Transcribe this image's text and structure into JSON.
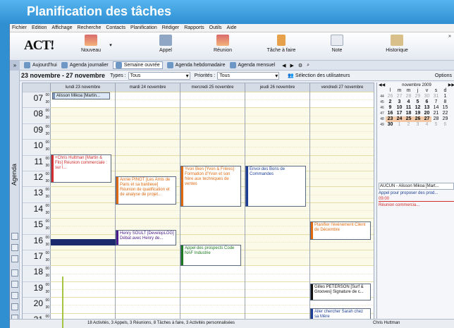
{
  "banner_title": "Planification des tâches",
  "menu": [
    "Fichier",
    "Edition",
    "Affichage",
    "Recherche",
    "Contacts",
    "Planification",
    "Rédiger",
    "Rapports",
    "Outils",
    "Aide"
  ],
  "toolbar": {
    "logo": "ACT!",
    "buttons": [
      "Nouveau",
      "Appel",
      "Réunion",
      "Tâche à faire",
      "Note",
      "Historique"
    ]
  },
  "nav": {
    "chevron": "»",
    "items": [
      "Aujourd'hui",
      "Agenda journalier",
      "Semaine ouvrée",
      "Agenda hebdomadaire",
      "Agenda mensuel"
    ]
  },
  "daterow": {
    "range": "23 novembre - 27 novembre",
    "types_label": "Types :",
    "types_value": "Tous",
    "prio_label": "Priorités :",
    "prio_value": "Tous",
    "users_label": "Sélection des utilisateurs",
    "options_label": "Options"
  },
  "agenda_label": "Agenda",
  "days": [
    "lundi 23 novembre",
    "mardi 24 novembre",
    "mercredi 25 novembre",
    "jeudi 26 novembre",
    "vendredi 27 novembre"
  ],
  "banner_event": "Alisson Mikoa [Martin...",
  "hours": [
    "07",
    "08",
    "09",
    "10",
    "11",
    "12",
    "13",
    "14",
    "15",
    "16",
    "17",
    "18",
    "19",
    "20",
    "21"
  ],
  "mins": [
    "00",
    "30"
  ],
  "events": [
    {
      "text": "+Chris Hultman [Martin & Fils] Réunion commerciale : sur l..."
    },
    {
      "text": "Annie PINOT [Les Amis de Paris et sa banlieue] Réunion de qualification et de analyse de projet..."
    },
    {
      "text": "Yvon Bien [Yvon & Frères] Formation d'Yvon et son frère aux techniques de ventes"
    },
    {
      "text": "Envoi des Bons de Commandes"
    },
    {
      "text": "Planifier l'événement Client de Décembre"
    },
    {
      "text": "Henry SOULT [DevelopLOG] Débat avec Henry de..."
    },
    {
      "text": "Appel des prospects Code NAF Industrie"
    },
    {
      "text": "Gilles PETERSON [Surf & Grooves] Signature de c..."
    },
    {
      "text": "Aller chercher Sarah chez sa Mère"
    }
  ],
  "calendar": {
    "month": "novembre 2009",
    "dow": [
      "l",
      "m",
      "m",
      "j",
      "v",
      "s",
      "d"
    ],
    "weeks": [
      [
        "44",
        "26",
        "27",
        "28",
        "29",
        "30",
        "31",
        "1"
      ],
      [
        "45",
        "2",
        "3",
        "4",
        "5",
        "6",
        "7",
        "8"
      ],
      [
        "46",
        "9",
        "10",
        "11",
        "12",
        "13",
        "14",
        "15"
      ],
      [
        "47",
        "16",
        "17",
        "18",
        "19",
        "20",
        "21",
        "22"
      ],
      [
        "48",
        "23",
        "24",
        "25",
        "26",
        "27",
        "28",
        "29"
      ],
      [
        "49",
        "30",
        "1",
        "2",
        "3",
        "4",
        "5",
        "6"
      ]
    ]
  },
  "todo": {
    "filter": "AUCUN - Alisson Mikoa [Mart...",
    "item1": "Appel pour proposer des prod...",
    "time": "09:00",
    "item2": "Réunion commercia..."
  },
  "statusbar": {
    "counts": "18 Activités, 3 Appels, 3 Réunions, 8 Tâches à faire, 3 Activités personnalisées",
    "user": "Chris Huttman"
  }
}
